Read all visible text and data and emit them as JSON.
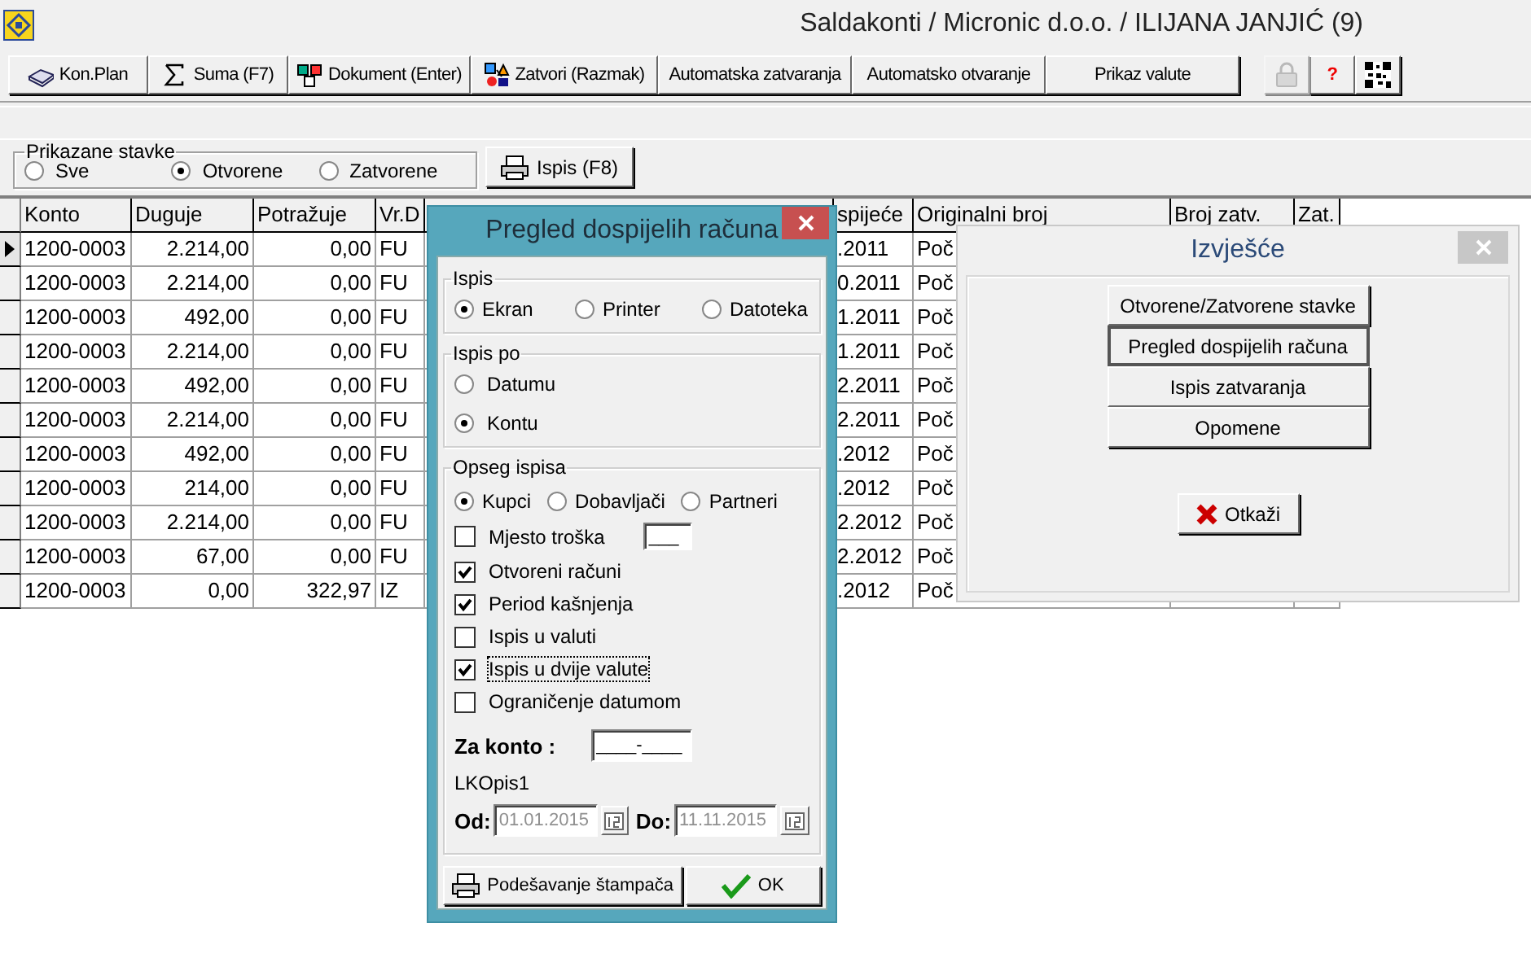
{
  "window": {
    "title": "Saldakonti / Micronic d.o.o.  / ILIJANA JANJIĆ (9)"
  },
  "toolbar": {
    "buttons": [
      {
        "label": "Kon.Plan"
      },
      {
        "label": "Suma (F7)"
      },
      {
        "label": "Dokument (Enter)"
      },
      {
        "label": "Zatvori (Razmak)"
      },
      {
        "label": "Automatska zatvaranja"
      },
      {
        "label": "Automatsko otvaranje"
      },
      {
        "label": "Prikaz valute"
      }
    ],
    "icon_buttons": [
      {
        "disabled": true
      },
      {
        "label": "?",
        "disabled": false
      },
      {
        "disabled": false
      }
    ]
  },
  "filter": {
    "label": "Prikazane stavke",
    "options": [
      {
        "label": "Sve",
        "selected": false
      },
      {
        "label": "Otvorene",
        "selected": true
      },
      {
        "label": "Zatvorene",
        "selected": false
      }
    ],
    "print_button": "Ispis (F8)"
  },
  "table": {
    "columns": [
      "Konto",
      "Duguje",
      "Potražuje",
      "Vr.D",
      "spijeće",
      "Originalni broj",
      "Broj zatv.",
      "Zat."
    ],
    "rows": [
      {
        "selected": true,
        "cells": [
          "1200-0003",
          "2.214,00",
          "0,00",
          "FU",
          ".2011",
          "Poč"
        ]
      },
      {
        "selected": false,
        "cells": [
          "1200-0003",
          "2.214,00",
          "0,00",
          "FU",
          "0.2011",
          "Poč"
        ]
      },
      {
        "selected": false,
        "cells": [
          "1200-0003",
          "492,00",
          "0,00",
          "FU",
          "1.2011",
          "Poč"
        ]
      },
      {
        "selected": false,
        "cells": [
          "1200-0003",
          "2.214,00",
          "0,00",
          "FU",
          "1.2011",
          "Poč"
        ]
      },
      {
        "selected": false,
        "cells": [
          "1200-0003",
          "492,00",
          "0,00",
          "FU",
          "2.2011",
          "Poč"
        ]
      },
      {
        "selected": false,
        "cells": [
          "1200-0003",
          "2.214,00",
          "0,00",
          "FU",
          "2.2011",
          "Poč"
        ]
      },
      {
        "selected": false,
        "cells": [
          "1200-0003",
          "492,00",
          "0,00",
          "FU",
          ".2012",
          "Poč"
        ]
      },
      {
        "selected": false,
        "cells": [
          "1200-0003",
          "214,00",
          "0,00",
          "FU",
          ".2012",
          "Poč"
        ]
      },
      {
        "selected": false,
        "cells": [
          "1200-0003",
          "2.214,00",
          "0,00",
          "FU",
          "2.2012",
          "Poč"
        ]
      },
      {
        "selected": false,
        "cells": [
          "1200-0003",
          "67,00",
          "0,00",
          "FU",
          "2.2012",
          "Poč"
        ]
      },
      {
        "selected": false,
        "cells": [
          "1200-0003",
          "0,00",
          "322,97",
          "IZ",
          ".2012",
          "Poč"
        ]
      }
    ]
  },
  "due_dialog": {
    "title": "Pregled dospijelih računa",
    "output": {
      "label": "Ispis",
      "options": [
        {
          "label": "Ekran",
          "selected": true
        },
        {
          "label": "Printer",
          "selected": false
        },
        {
          "label": "Datoteka",
          "selected": false
        }
      ]
    },
    "order": {
      "label": "Ispis po",
      "options": [
        {
          "label": "Datumu",
          "selected": false
        },
        {
          "label": "Kontu",
          "selected": true
        }
      ]
    },
    "scope": {
      "label": "Opseg ispisa",
      "options": [
        {
          "label": "Kupci",
          "selected": true
        },
        {
          "label": "Dobavljači",
          "selected": false
        },
        {
          "label": "Partneri",
          "selected": false
        }
      ],
      "checks": [
        {
          "label": "Mjesto troška",
          "checked": false,
          "focused": false,
          "value": "___"
        },
        {
          "label": "Otvoreni računi",
          "checked": true,
          "focused": false
        },
        {
          "label": "Period kašnjenja",
          "checked": true,
          "focused": false
        },
        {
          "label": "Ispis u valuti",
          "checked": false,
          "focused": false
        },
        {
          "label": "Ispis u dvije valute",
          "checked": true,
          "focused": true
        },
        {
          "label": "Ograničenje datumom",
          "checked": false,
          "focused": false
        }
      ],
      "account_label": "Za konto :",
      "account_value": "____-____",
      "caption": "LKOpis1",
      "from_label": "Od:",
      "from_value": "01.01.2015",
      "to_label": "Do:",
      "to_value": "11.11.2015",
      "dates_disabled": true
    },
    "printer_button": "Podešavanje štampača",
    "ok_button": "OK"
  },
  "report_dialog": {
    "title": "Izvješće",
    "buttons": [
      {
        "label": "Otvorene/Zatvorene stavke",
        "selected": false
      },
      {
        "label": "Pregled dospijelih računa",
        "selected": true
      },
      {
        "label": "Ispis zatvaranja",
        "selected": false
      },
      {
        "label": "Opomene",
        "selected": false
      }
    ],
    "cancel_button": "Otkaži"
  }
}
